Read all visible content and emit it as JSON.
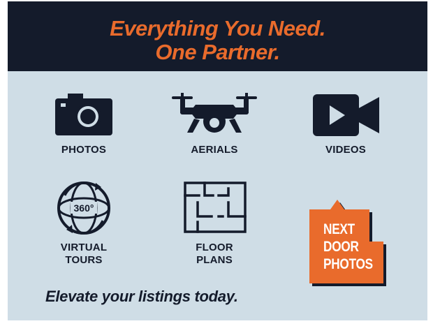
{
  "header": {
    "line1": "Everything You Need.",
    "line2": "One Partner."
  },
  "services": [
    {
      "label": "PHOTOS",
      "icon": "camera-icon"
    },
    {
      "label": "AERIALS",
      "icon": "drone-icon"
    },
    {
      "label": "VIDEOS",
      "icon": "video-camera-icon"
    },
    {
      "label_lines": [
        "VIRTUAL",
        "TOURS"
      ],
      "icon": "360-tour-icon",
      "icon_text": "360°"
    },
    {
      "label_lines": [
        "FLOOR",
        "PLANS"
      ],
      "icon": "floor-plan-icon"
    }
  ],
  "logo": {
    "lines": [
      "NEXT",
      "DOOR",
      "PHOTOS"
    ],
    "icon": "next-door-photos-logo"
  },
  "tagline": "Elevate your listings today.",
  "colors": {
    "header_bg": "#141b2b",
    "accent": "#e96b2c",
    "panel_bg": "#cfdde6",
    "ink": "#141b2b"
  }
}
